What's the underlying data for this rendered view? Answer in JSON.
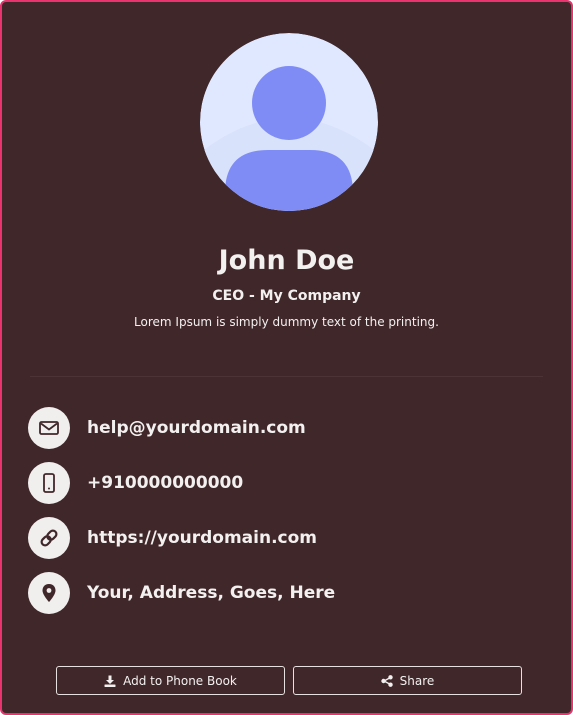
{
  "profile": {
    "name": "John Doe",
    "title": "CEO - My Company",
    "bio": "Lorem Ipsum is simply dummy text of the printing."
  },
  "contacts": [
    {
      "icon": "envelope-icon",
      "text": "help@yourdomain.com"
    },
    {
      "icon": "mobile-phone-icon",
      "text": "+910000000000"
    },
    {
      "icon": "link-icon",
      "text": "https://yourdomain.com"
    },
    {
      "icon": "map-pin-icon",
      "text": "Your, Address, Goes, Here"
    }
  ],
  "actions": {
    "add_label": "Add to Phone Book",
    "share_label": "Share"
  },
  "colors": {
    "background": "#40272a",
    "border": "#e8336f",
    "avatar_bg": "#e0e8ff",
    "avatar_figure": "#7f8cf5",
    "icon_bg": "#f1eeee",
    "text": "#f3f0f0"
  }
}
